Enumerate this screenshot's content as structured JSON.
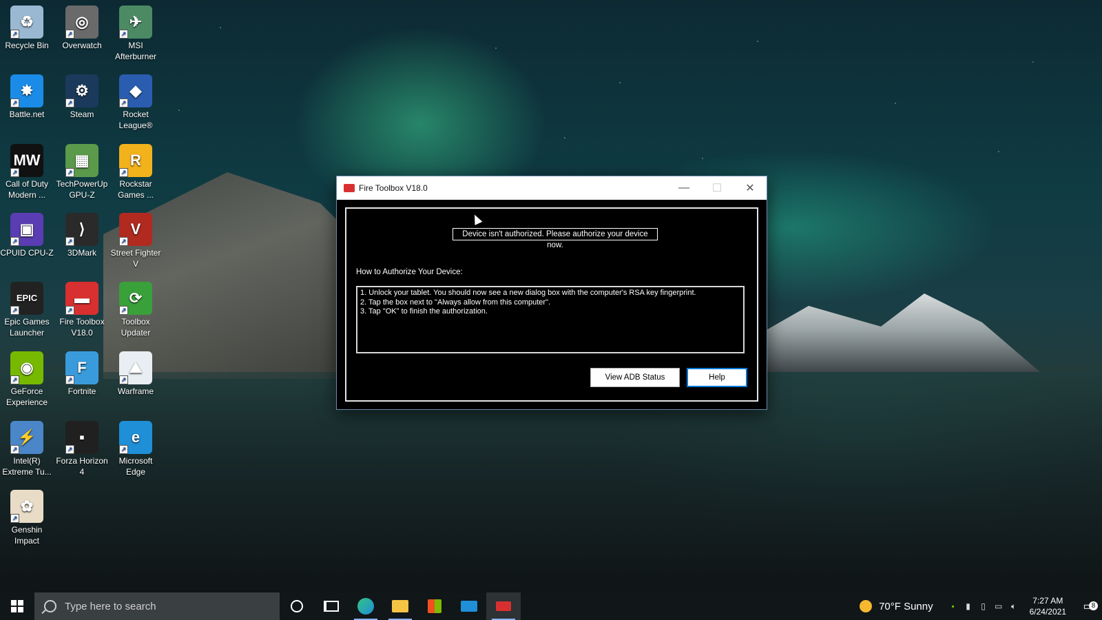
{
  "desktop": {
    "icons": [
      {
        "label": "Recycle Bin",
        "icon": "recycle-bin-icon",
        "color": "#9bb8d3",
        "glyph": "♻"
      },
      {
        "label": "Overwatch",
        "icon": "overwatch-icon",
        "color": "#6a6a6a",
        "glyph": "◎"
      },
      {
        "label": "MSI Afterburner",
        "icon": "msi-afterburner-icon",
        "color": "#4c8a64",
        "glyph": "✈"
      },
      {
        "label": "Battle.net",
        "icon": "battlenet-icon",
        "color": "#1a8ce8",
        "glyph": "✸"
      },
      {
        "label": "Steam",
        "icon": "steam-icon",
        "color": "#1b3a5b",
        "glyph": "⚙"
      },
      {
        "label": "Rocket League®",
        "icon": "rocket-league-icon",
        "color": "#2a5db0",
        "glyph": "◆"
      },
      {
        "label": "Call of Duty Modern ...",
        "icon": "call-of-duty-icon",
        "color": "#111111",
        "glyph": "MW"
      },
      {
        "label": "TechPowerUp GPU-Z",
        "icon": "gpu-z-icon",
        "color": "#5b9a4a",
        "glyph": "▦"
      },
      {
        "label": "Rockstar Games ...",
        "icon": "rockstar-icon",
        "color": "#f2b21c",
        "glyph": "R"
      },
      {
        "label": "CPUID CPU-Z",
        "icon": "cpu-z-icon",
        "color": "#5a3db2",
        "glyph": "▣"
      },
      {
        "label": "3DMark",
        "icon": "3dmark-icon",
        "color": "#2a2a2a",
        "glyph": "⟩"
      },
      {
        "label": "Street Fighter V",
        "icon": "street-fighter-icon",
        "color": "#b12a1f",
        "glyph": "V"
      },
      {
        "label": "Epic Games Launcher",
        "icon": "epic-games-icon",
        "color": "#222222",
        "glyph": "EPIC"
      },
      {
        "label": "Fire Toolbox V18.0",
        "icon": "fire-toolbox-icon",
        "color": "#d83030",
        "glyph": "▬"
      },
      {
        "label": "Toolbox Updater",
        "icon": "toolbox-updater-icon",
        "color": "#3aa03a",
        "glyph": "⟳"
      },
      {
        "label": "GeForce Experience",
        "icon": "geforce-icon",
        "color": "#76b900",
        "glyph": "◉"
      },
      {
        "label": "Fortnite",
        "icon": "fortnite-icon",
        "color": "#3a9bdc",
        "glyph": "F"
      },
      {
        "label": "Warframe",
        "icon": "warframe-icon",
        "color": "#e8eef2",
        "glyph": "⛰"
      },
      {
        "label": "Intel(R) Extreme Tu...",
        "icon": "intel-xtu-icon",
        "color": "#4a86c8",
        "glyph": "⚡"
      },
      {
        "label": "Forza Horizon 4",
        "icon": "forza-icon",
        "color": "#202020",
        "glyph": "▪"
      },
      {
        "label": "Microsoft Edge",
        "icon": "edge-icon",
        "color": "#1f8fd8",
        "glyph": "e"
      },
      {
        "label": "Genshin Impact",
        "icon": "genshin-icon",
        "color": "#e9dcc6",
        "glyph": "✿"
      }
    ]
  },
  "window": {
    "title": "Fire Toolbox V18.0",
    "status_message": "Device isn't authorized. Please authorize your device now.",
    "howto_label": "How to Authorize Your Device:",
    "steps": [
      "1. Unlock your tablet. You should now see a new dialog box with the computer's RSA key fingerprint.",
      "2. Tap the box next to \"Always allow from this computer\".",
      "3. Tap \"OK\" to finish the authorization."
    ],
    "view_adb_label": "View ADB Status",
    "help_label": "Help",
    "minimize_glyph": "—",
    "maximize_glyph": "☐",
    "close_glyph": "✕"
  },
  "taskbar": {
    "search_placeholder": "Type here to search",
    "weather": "70°F  Sunny",
    "time": "7:27 AM",
    "date": "6/24/2021",
    "notification_count": "8"
  }
}
